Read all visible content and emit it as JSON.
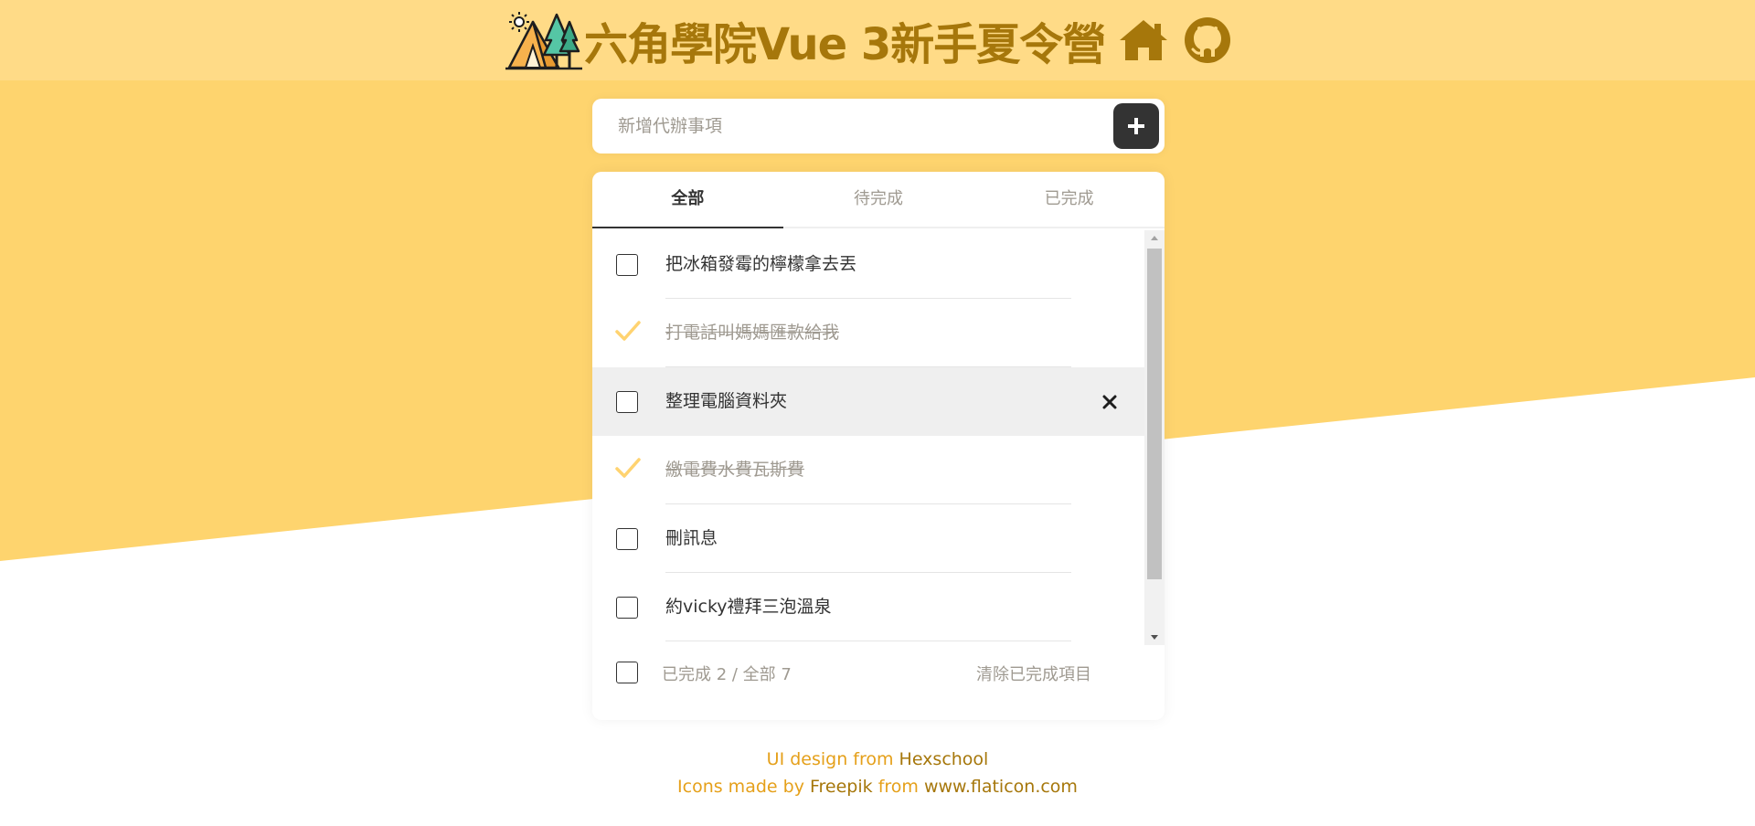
{
  "header": {
    "title": "六角學院Vue 3新手夏令營",
    "home_icon": "home-icon",
    "github_icon": "github-icon",
    "logo": "camping-tent-logo"
  },
  "add_todo": {
    "placeholder": "新增代辦事項",
    "button_icon": "plus-icon"
  },
  "tabs": [
    {
      "label": "全部",
      "active": true
    },
    {
      "label": "待完成",
      "active": false
    },
    {
      "label": "已完成",
      "active": false
    }
  ],
  "todos": [
    {
      "text": "把冰箱發霉的檸檬拿去丟",
      "done": false
    },
    {
      "text": "打電話叫媽媽匯款給我",
      "done": true
    },
    {
      "text": "整理電腦資料夾",
      "done": false,
      "hovered": true
    },
    {
      "text": "繳電費水費瓦斯費",
      "done": true
    },
    {
      "text": "刪訊息",
      "done": false
    },
    {
      "text": "約vicky禮拜三泡溫泉",
      "done": false
    }
  ],
  "footer": {
    "count_text": "已完成 2 / 全部 7",
    "clear_label": "清除已完成項目"
  },
  "credits": {
    "line1_prefix": "UI design from ",
    "line1_link": "Hexschool",
    "line2_prefix": "Icons made by ",
    "line2_link1": "Freepik",
    "line2_mid": " from ",
    "line2_link2": "www.flaticon.com"
  },
  "colors": {
    "background_yellow": "#fed46e",
    "header_yellow": "#ffdb87",
    "title_brown": "#a6770b",
    "accent_orange": "#e5a01a",
    "check_yellow": "#ffd370",
    "dark": "#333333",
    "muted": "#9f9a91"
  }
}
